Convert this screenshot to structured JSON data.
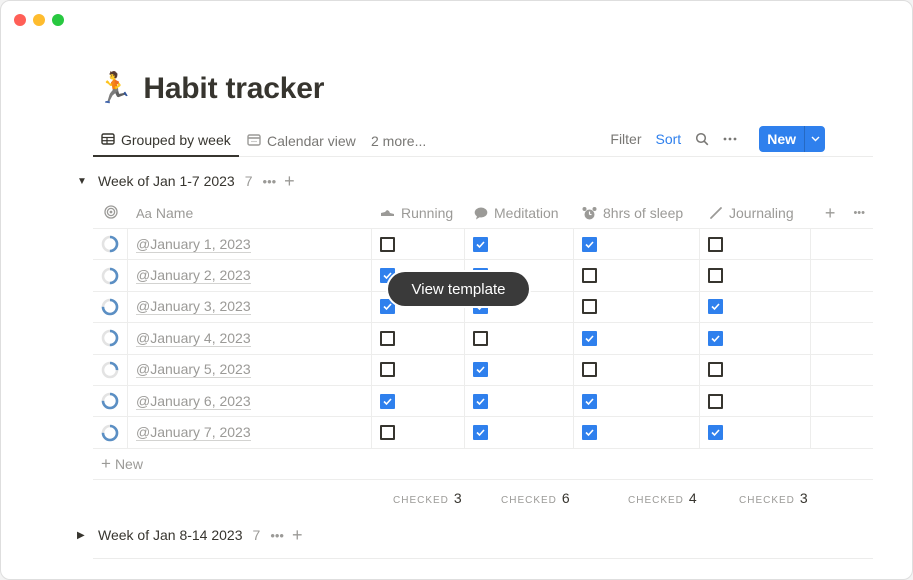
{
  "window": {
    "controls": [
      "close",
      "minimize",
      "maximize"
    ]
  },
  "page": {
    "icon": "🏃",
    "title": "Habit tracker"
  },
  "views": {
    "tabs": [
      {
        "label": "Grouped by week",
        "icon": "table-icon",
        "active": true
      },
      {
        "label": "Calendar view",
        "icon": "calendar-icon",
        "active": false
      }
    ],
    "more_label": "2 more...",
    "actions": {
      "filter": "Filter",
      "sort": "Sort",
      "search_icon": "search-icon",
      "more_icon": "more-icon",
      "new_label": "New"
    }
  },
  "columns": {
    "name": {
      "prefix": "Aa",
      "label": "Name"
    },
    "habits": [
      {
        "key": "running",
        "label": "Running",
        "icon": "shoe-icon"
      },
      {
        "key": "meditation",
        "label": "Meditation",
        "icon": "speech-bubble-icon"
      },
      {
        "key": "sleep",
        "label": "8hrs of sleep",
        "icon": "alarm-clock-icon"
      },
      {
        "key": "journaling",
        "label": "Journaling",
        "icon": "pencil-icon"
      }
    ]
  },
  "groups": [
    {
      "name": "Week of Jan 1-7 2023",
      "count": "7",
      "expanded": true,
      "rows": [
        {
          "name": "@January 1, 2023",
          "progress": 0.5,
          "running": false,
          "meditation": true,
          "sleep": true,
          "journaling": false
        },
        {
          "name": "@January 2, 2023",
          "progress": 0.5,
          "running": true,
          "meditation": true,
          "sleep": false,
          "journaling": false
        },
        {
          "name": "@January 3, 2023",
          "progress": 0.75,
          "running": true,
          "meditation": true,
          "sleep": false,
          "journaling": true
        },
        {
          "name": "@January 4, 2023",
          "progress": 0.5,
          "running": false,
          "meditation": false,
          "sleep": true,
          "journaling": true
        },
        {
          "name": "@January 5, 2023",
          "progress": 0.25,
          "running": false,
          "meditation": true,
          "sleep": false,
          "journaling": false
        },
        {
          "name": "@January 6, 2023",
          "progress": 0.75,
          "running": true,
          "meditation": true,
          "sleep": true,
          "journaling": false
        },
        {
          "name": "@January 7, 2023",
          "progress": 0.75,
          "running": false,
          "meditation": true,
          "sleep": true,
          "journaling": true
        }
      ],
      "new_label": "New",
      "calcs": [
        {
          "label": "CHECKED",
          "value": "3"
        },
        {
          "label": "CHECKED",
          "value": "6"
        },
        {
          "label": "CHECKED",
          "value": "4"
        },
        {
          "label": "CHECKED",
          "value": "3"
        }
      ]
    },
    {
      "name": "Week of Jan 8-14 2023",
      "count": "7",
      "expanded": false
    }
  ],
  "tooltip": "View template",
  "colors": {
    "accent": "#2f80ed",
    "progress": "#5b8fc4",
    "progress_track": "#e3e3e3"
  }
}
